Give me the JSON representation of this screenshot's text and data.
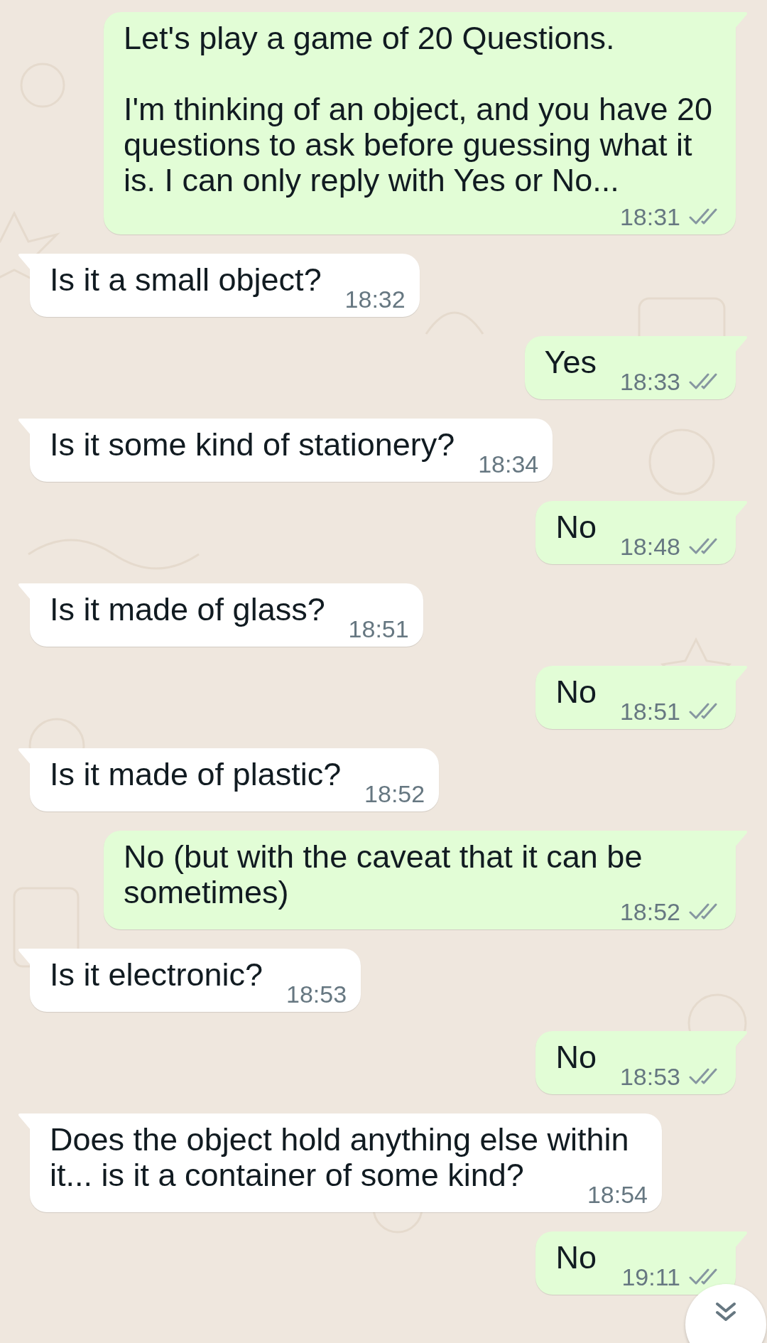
{
  "messages": [
    {
      "kind": "outgoing",
      "text": "Let's play a game of 20 Questions.\n\nI'm thinking of an object, and you have 20 questions to ask before guessing what it is. I can only reply with Yes or No...",
      "time": "18:31",
      "read": false
    },
    {
      "kind": "incoming",
      "text": "Is it a small object?",
      "time": "18:32"
    },
    {
      "kind": "outgoing",
      "text": "Yes",
      "time": "18:33",
      "read": false
    },
    {
      "kind": "incoming",
      "text": "Is it some kind of stationery?",
      "time": "18:34"
    },
    {
      "kind": "outgoing",
      "text": "No",
      "time": "18:48",
      "read": false
    },
    {
      "kind": "incoming",
      "text": "Is it made of glass?",
      "time": "18:51"
    },
    {
      "kind": "outgoing",
      "text": "No",
      "time": "18:51",
      "read": false
    },
    {
      "kind": "incoming",
      "text": "Is it made of plastic?",
      "time": "18:52"
    },
    {
      "kind": "outgoing",
      "text": "No (but with the caveat that it can be sometimes)",
      "time": "18:52",
      "read": false
    },
    {
      "kind": "incoming",
      "text": "Is it electronic?",
      "time": "18:53"
    },
    {
      "kind": "outgoing",
      "text": "No",
      "time": "18:53",
      "read": false
    },
    {
      "kind": "incoming",
      "text": "Does the object hold anything else within it... is it a container of some kind?",
      "time": "18:54"
    },
    {
      "kind": "outgoing",
      "text": "No",
      "time": "19:11",
      "read": false
    }
  ]
}
